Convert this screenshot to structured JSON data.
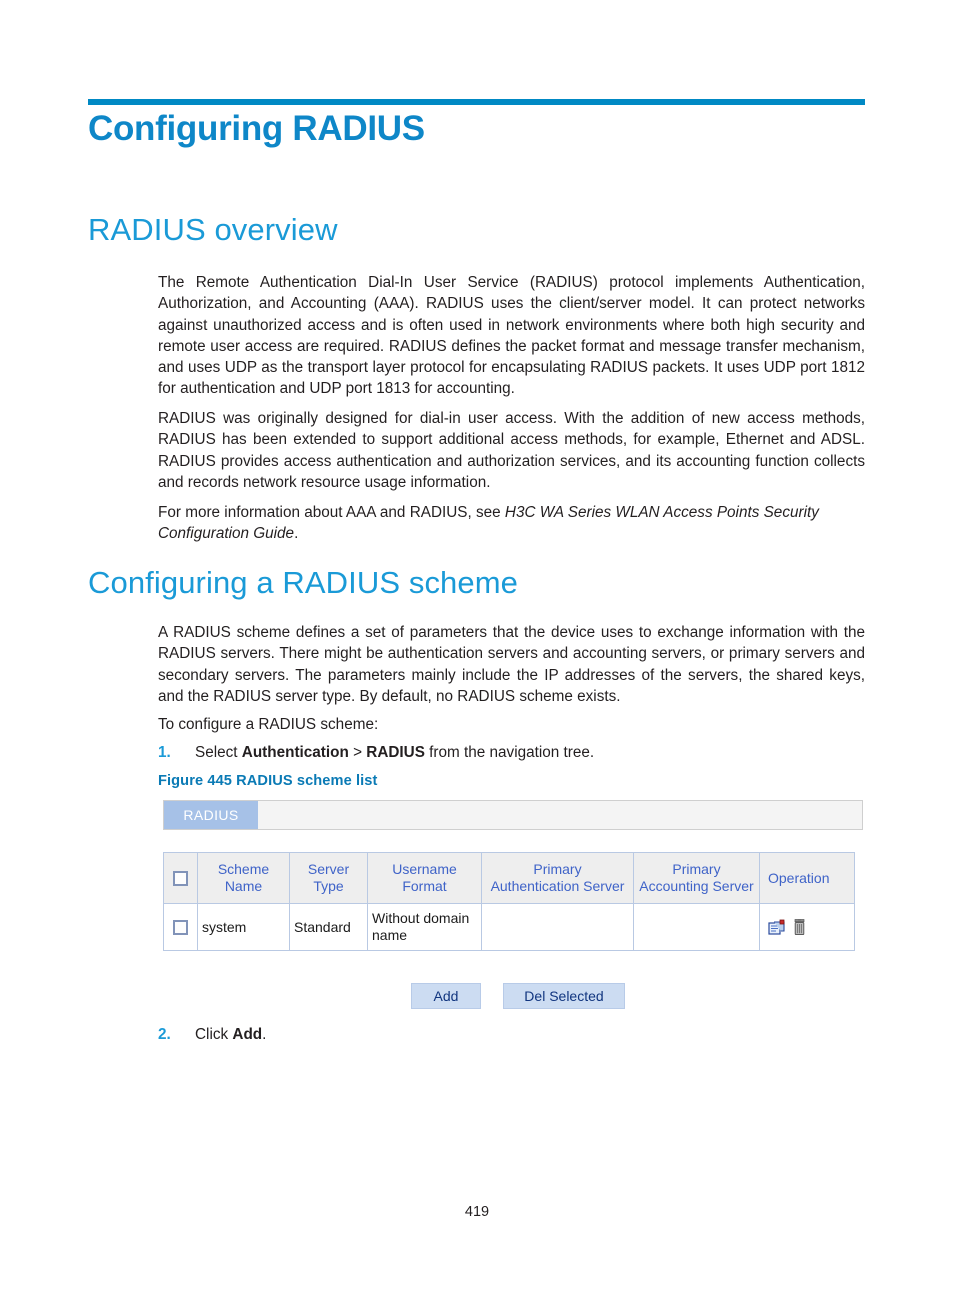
{
  "document": {
    "chapter_title": "Configuring RADIUS",
    "page_number": "419"
  },
  "sections": {
    "overview": {
      "heading": "RADIUS overview",
      "paragraph_1": "The Remote Authentication Dial-In User Service (RADIUS) protocol implements Authentication, Authorization, and Accounting (AAA). RADIUS uses the client/server model. It can protect networks against unauthorized access and is often used in network environments where both high security and remote user access are required. RADIUS defines the packet format and message transfer mechanism, and uses UDP as the transport layer protocol for encapsulating RADIUS packets. It uses UDP port 1812 for authentication and UDP port 1813 for accounting.",
      "paragraph_2": "RADIUS was originally designed for dial-in user access. With the addition of new access methods, RADIUS has been extended to support additional access methods, for example, Ethernet and ADSL. RADIUS provides access authentication and authorization services, and its accounting function collects and records network resource usage information.",
      "paragraph_3_prefix": "For more information about AAA and RADIUS, see ",
      "paragraph_3_italic": "H3C WA Series WLAN Access Points Security Configuration Guide",
      "paragraph_3_suffix": "."
    },
    "scheme": {
      "heading": "Configuring a RADIUS scheme",
      "paragraph_1": "A RADIUS scheme defines a set of parameters that the device uses to exchange information with the RADIUS servers. There might be authentication servers and accounting servers, or primary servers and secondary servers. The parameters mainly include the IP addresses of the servers, the shared keys, and the RADIUS server type. By default, no RADIUS scheme exists.",
      "lead_in": "To configure a RADIUS scheme:",
      "steps": [
        {
          "number": "1.",
          "text_1": "Select ",
          "bold_1": "Authentication",
          "text_2": " > ",
          "bold_2": "RADIUS",
          "text_3": " from the navigation tree."
        },
        {
          "number": "2.",
          "text_1": "Click ",
          "bold_1": "Add",
          "text_2": "."
        }
      ],
      "figure_caption": "Figure 445 RADIUS scheme list"
    }
  },
  "screenshot": {
    "tabs": [
      {
        "label": "RADIUS",
        "active": true
      }
    ],
    "table": {
      "select_all_checkbox": "",
      "columns": [
        {
          "id": "check",
          "label": ""
        },
        {
          "id": "scheme_name",
          "label": "Scheme\nName",
          "line1": "Scheme",
          "line2": "Name"
        },
        {
          "id": "server_type",
          "label": "Server\nType",
          "line1": "Server",
          "line2": "Type"
        },
        {
          "id": "username_format",
          "label": "Username\nFormat",
          "line1": "Username",
          "line2": "Format"
        },
        {
          "id": "primary_auth_server",
          "label": "Primary\nAuthentication Server",
          "line1": "Primary",
          "line2": "Authentication Server"
        },
        {
          "id": "primary_acct_server",
          "label": "Primary\nAccounting Server",
          "line1": "Primary",
          "line2": "Accounting Server"
        },
        {
          "id": "operation",
          "label": "Operation",
          "line1": "Operation",
          "line2": ""
        }
      ],
      "rows": [
        {
          "scheme_name": "system",
          "server_type": "Standard",
          "username_format": "Without domain name",
          "primary_auth_server": "",
          "primary_acct_server": "",
          "operation_icons": [
            "edit-icon",
            "delete-icon"
          ]
        }
      ]
    },
    "buttons": [
      {
        "id": "add",
        "label": "Add"
      },
      {
        "id": "del_selected",
        "label": "Del Selected"
      }
    ]
  },
  "colors": {
    "chapter_title": "#0e87c8",
    "heading": "#1a9ad7",
    "rule": "#0089c4",
    "figure_caption": "#0a7ab5",
    "step_number": "#1a9ad7",
    "tab_active_bg": "#a6c1e7",
    "table_header_text": "#3f63c8",
    "table_header_bg": "#eeeeee",
    "table_border": "#b9c9e3",
    "button_bg": "#ccdcf2",
    "button_text": "#11357f",
    "body_text": "#231f20"
  }
}
